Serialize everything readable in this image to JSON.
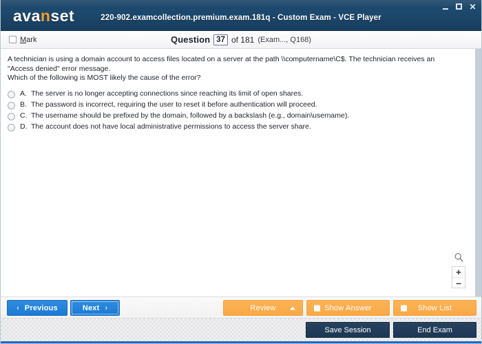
{
  "window": {
    "title": "220-902.examcollection.premium.exam.181q - Custom Exam - VCE Player",
    "logo_text_1": "ava",
    "logo_text_hl": "n",
    "logo_text_2": "set",
    "controls": {
      "minimize": "minimize-icon",
      "maximize": "maximize-icon",
      "close": "✕"
    },
    "accent_dark": "#1d496e",
    "accent_orange": "#f5a02a"
  },
  "question_header": {
    "mark_label_prefix": "M",
    "mark_label_rest": "ark",
    "question_word": "Question",
    "question_number": "37",
    "of_text": "of 181",
    "context": "(Exam..., Q168)"
  },
  "question": {
    "text_line_1": "A technician is using a domain account to access files located on a server at the path \\\\computername\\C$. The technician receives an \"Access denied\" error message.",
    "text_line_2": "Which of the following is MOST likely the cause of the error?",
    "options": [
      {
        "letter": "A.",
        "text": "The server is no longer accepting connections since reaching its limit of open shares.",
        "selected": false
      },
      {
        "letter": "B.",
        "text": "The password is incorrect, requiring the user to reset it before authentication will proceed.",
        "selected": false
      },
      {
        "letter": "C.",
        "text": "The username should be prefixed by the domain, followed by a backslash (e.g., domain\\username).",
        "selected": false
      },
      {
        "letter": "D.",
        "text": "The account does not have local administrative permissions to access the server share.",
        "selected": false
      }
    ]
  },
  "zoom_control": {
    "magnifier": "search-icon",
    "zoom_in": "+",
    "zoom_out": "–"
  },
  "toolbar": {
    "previous_label": "Previous",
    "previous_chevron": "‹",
    "next_label": "Next",
    "next_chevron": "›",
    "review_label": "Review",
    "show_answer_label": "Show Answer",
    "show_list_label": "Show List"
  },
  "statusbar": {
    "save_session_label": "Save Session",
    "end_exam_label": "End Exam"
  }
}
